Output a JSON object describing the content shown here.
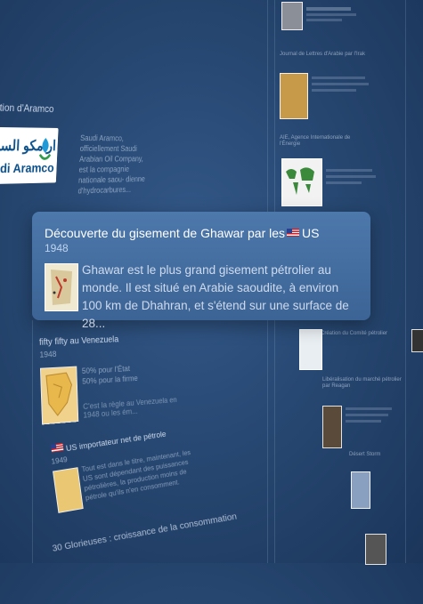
{
  "left_section": {
    "title": "dation d'Aramco",
    "logo_arabic": "ارامكو السعو",
    "logo_latin": "audi Aramco",
    "description": "Saudi Aramco, officiellement Saudi Arabian Oil Company, est la compagnie nationale saou- dienne d'hydrocarbures..."
  },
  "popup": {
    "title_prefix": "Découverte du gisement de Ghawar par les",
    "title_suffix": "US",
    "year": "1948",
    "text": "Ghawar est le plus grand gisement pétrolier au monde. Il est situé en Arabie saoudite, à environ 100 km de Dhahran, et s'étend sur une surface de 28..."
  },
  "venezuela": {
    "title": "fifty fifty au Venezuela",
    "year": "1948",
    "line1": "50% pour l'État",
    "line2": "50% pour la firme",
    "line3": "C'est la règle au Venezuela en 1948 ou les ém..."
  },
  "importer": {
    "title_prefix": "US",
    "title_suffix": "importateur net de pétrole",
    "year": "1949",
    "text": "Tout est dans le titre, maintenant, les US sont dépendant des puissances pétrolières, la production moins de pétrole qu'ils n'en consomment."
  },
  "consumption": {
    "title": "30 Glorieuses : croissance de la consommation"
  },
  "right_panels": {
    "r1": "Journal de Lettres d'Arabie par l'Irak",
    "r2": "AIE, Agence Internationale de l'Énergie",
    "r3": "Création du Comité pétrolier",
    "r4": "Libéralisation du marché pétrolier par Reagan",
    "r5": "Désert Storm"
  }
}
